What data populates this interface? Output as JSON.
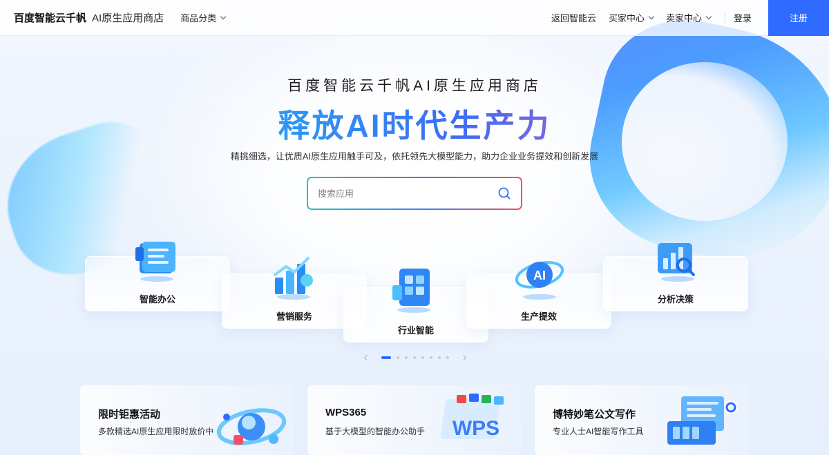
{
  "header": {
    "logo_main": "百度智能云千帆",
    "logo_sub": "AI原生应用商店",
    "category_label": "商品分类",
    "back_label": "返回智能云",
    "buyer_label": "买家中心",
    "seller_label": "卖家中心",
    "login_label": "登录",
    "register_label": "注册"
  },
  "hero": {
    "subtitle": "百度智能云千帆AI原生应用商店",
    "title": "释放AI时代生产力",
    "description": "精挑细选，让优质AI原生应用触手可及，依托领先大模型能力，助力企业业务提效和创新发展"
  },
  "search": {
    "placeholder": "搜索应用",
    "icon": "search-icon"
  },
  "categories": [
    {
      "label": "智能办公",
      "icon": "document-icon"
    },
    {
      "label": "营销服务",
      "icon": "growth-chart-icon"
    },
    {
      "label": "行业智能",
      "icon": "industry-grid-icon"
    },
    {
      "label": "生产提效",
      "icon": "ai-badge-icon"
    },
    {
      "label": "分析决策",
      "icon": "analytics-icon"
    }
  ],
  "carousel": {
    "total_dots": 8,
    "active_index": 0
  },
  "promos": [
    {
      "title": "限时钜惠活动",
      "desc": "多款精选AI原生应用限时放价中"
    },
    {
      "title": "WPS365",
      "desc": "基于大模型的智能办公助手",
      "art_text": "WPS"
    },
    {
      "title": "博特妙笔公文写作",
      "desc": "专业人士AI智能写作工具"
    }
  ],
  "colors": {
    "primary": "#2f6bff",
    "title_gradient_start": "#23c3d1",
    "title_gradient_end": "#f04a4a"
  }
}
